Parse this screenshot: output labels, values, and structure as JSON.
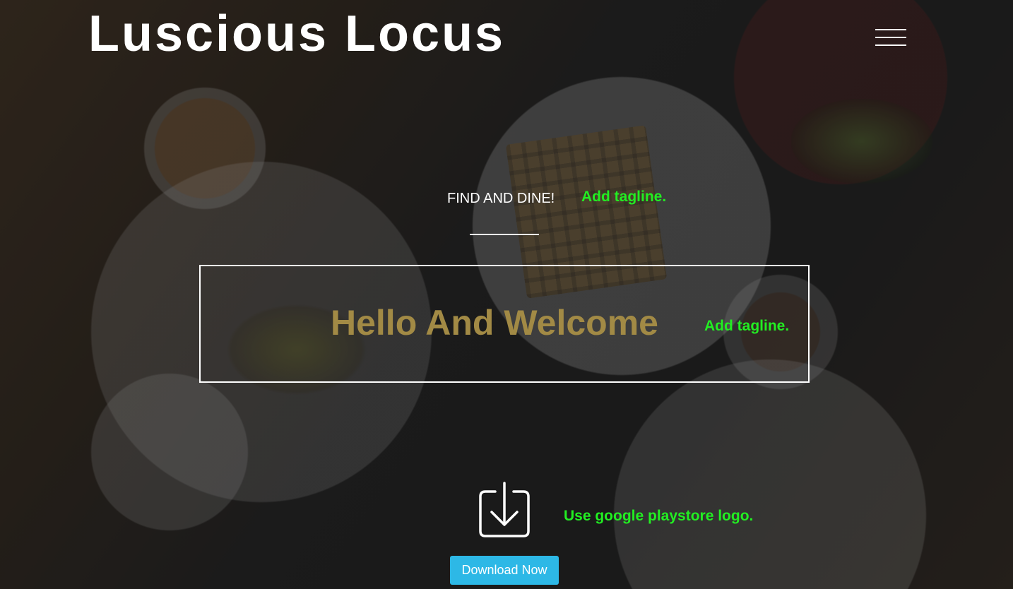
{
  "header": {
    "site_title": "Luscious Locus",
    "menu_icon": "hamburger-menu-icon"
  },
  "hero": {
    "subtitle": "FIND AND DINE!",
    "subtitle_note": "Add tagline.",
    "welcome_heading": "Hello And Welcome",
    "welcome_note": "Add tagline.",
    "heading_color": "#a28a45",
    "note_color": "#22ee22"
  },
  "download": {
    "icon": "download-icon",
    "icon_note": "Use google playstore logo.",
    "button_label": "Download Now",
    "button_color": "#2db8e6"
  }
}
